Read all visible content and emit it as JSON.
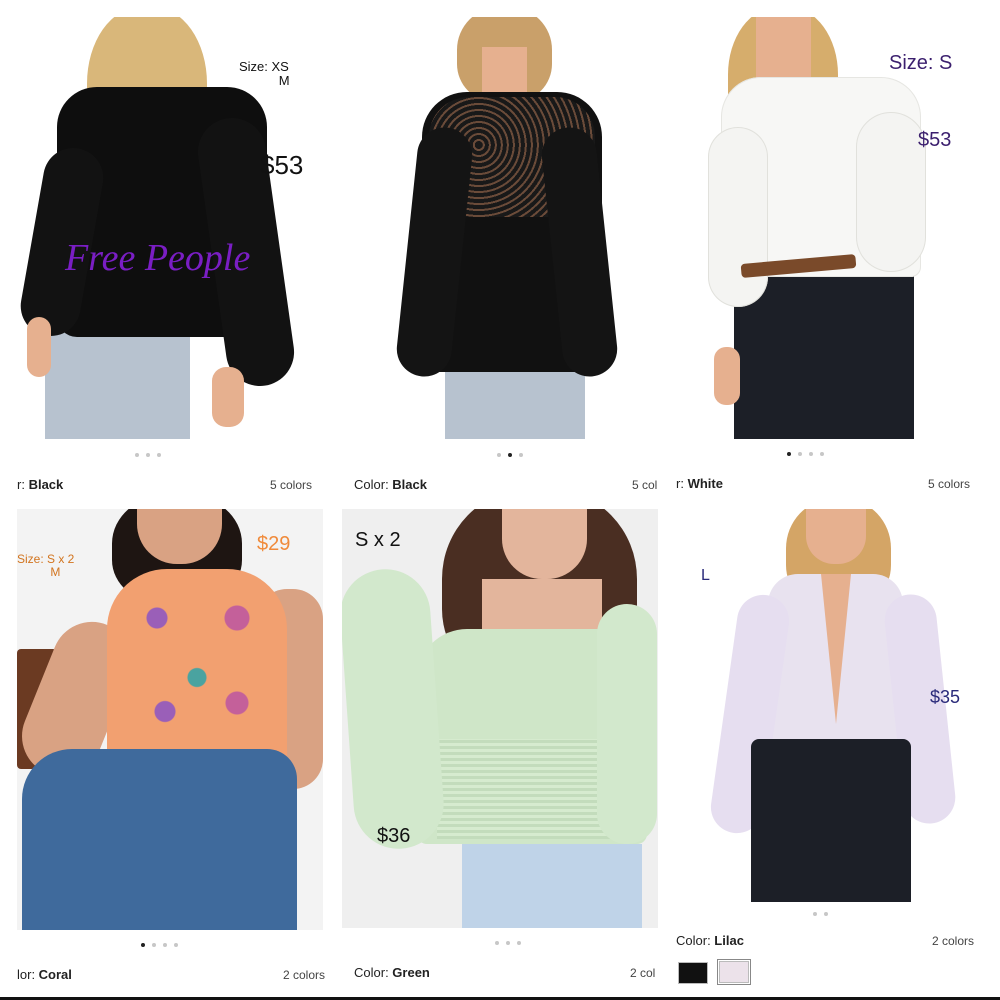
{
  "products": [
    {
      "color_prefix": "r: ",
      "color_name": "Black",
      "colors_count": "5 colors",
      "overlays": {
        "size": "Size: XS\n           M",
        "price": "$53",
        "brand": "Free People"
      }
    },
    {
      "color_prefix": "Color: ",
      "color_name": "Black",
      "colors_count": "5 col"
    },
    {
      "color_prefix": "r: ",
      "color_name": "White",
      "colors_count": "5 colors",
      "overlays": {
        "size": "Size: S",
        "price": "$53"
      }
    },
    {
      "color_prefix": "lor: ",
      "color_name": "Coral",
      "colors_count": "2 colors",
      "overlays": {
        "size": "Size: S x 2\n          M",
        "price": "$29"
      }
    },
    {
      "color_prefix": "Color: ",
      "color_name": "Green",
      "colors_count": "2 col",
      "overlays": {
        "size": "S x 2",
        "price": "$36"
      }
    },
    {
      "color_prefix": "Color: ",
      "color_name": "Lilac",
      "colors_count": "2 colors",
      "overlays": {
        "size": "L",
        "price": "$35"
      },
      "swatches": [
        {
          "name": "Black",
          "hex": "#111111"
        },
        {
          "name": "Lilac",
          "hex": "#ece2ea"
        }
      ]
    }
  ],
  "colors": {
    "overlay_black": "#111111",
    "overlay_purple": "#5a2a8a",
    "brand_purple": "#7a1ec4",
    "overlay_orange": "#f08a3a",
    "overlay_navy": "#2a2a7a",
    "dot_active": "#222222",
    "dot_inactive": "#c7c7c7"
  }
}
